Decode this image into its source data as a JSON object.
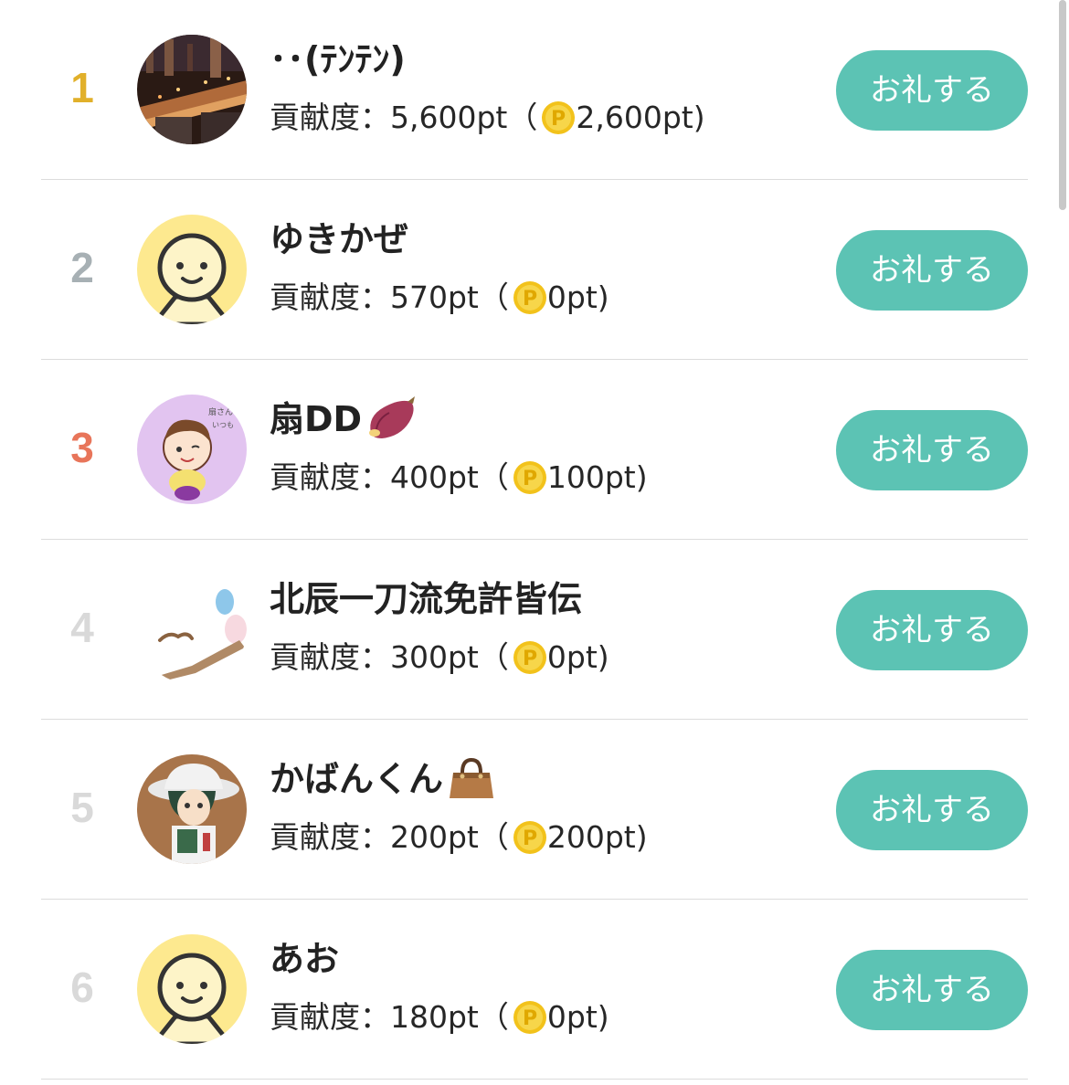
{
  "accent_color": "#5cc3b4",
  "rank_colors": [
    "#e1b02a",
    "#a7b0b4",
    "#e8755a",
    "#d9d9d9",
    "#d9d9d9",
    "#d9d9d9"
  ],
  "thanks_label": "お礼する",
  "stats_prefix": "貢献度：",
  "stats_open": "（",
  "stats_close": ")",
  "ranking": [
    {
      "rank": "1",
      "name": "･･(ﾃﾝﾃﾝ)",
      "contribution": "5,600pt",
      "points": "2,600pt",
      "avatar": "city-night-avatar",
      "emoji": null
    },
    {
      "rank": "2",
      "name": "ゆきかぜ",
      "contribution": "570pt",
      "points": "0pt",
      "avatar": "default-smiley-avatar",
      "emoji": null
    },
    {
      "rank": "3",
      "name": "扇DD",
      "contribution": "400pt",
      "points": "100pt",
      "avatar": "drawn-character-avatar",
      "emoji": "sweet-potato-icon"
    },
    {
      "rank": "4",
      "name": "北辰一刀流免許皆伝",
      "contribution": "300pt",
      "points": "0pt",
      "avatar": "sketch-avatar",
      "emoji": null
    },
    {
      "rank": "5",
      "name": "かばんくん",
      "contribution": "200pt",
      "points": "200pt",
      "avatar": "explorer-figure-avatar",
      "emoji": "handbag-icon"
    },
    {
      "rank": "6",
      "name": "あお",
      "contribution": "180pt",
      "points": "0pt",
      "avatar": "default-smiley-avatar",
      "emoji": null
    }
  ]
}
